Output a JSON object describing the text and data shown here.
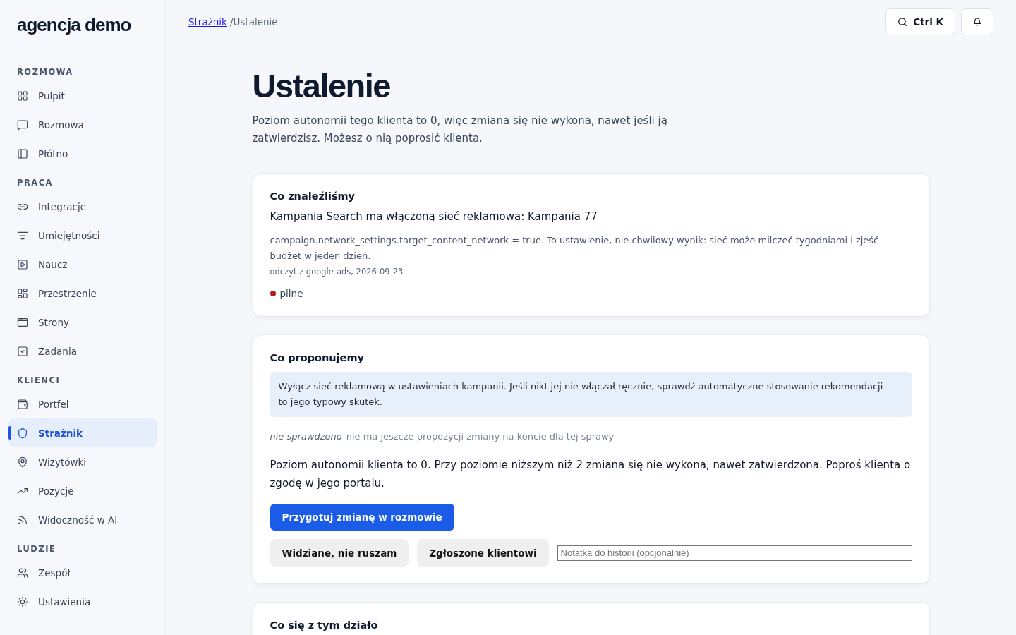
{
  "brand": "agencja demo",
  "sidebar": {
    "sections": [
      {
        "title": "ROZMOWA",
        "items": [
          {
            "label": "Pulpit",
            "selected": false
          },
          {
            "label": "Rozmowa",
            "selected": false
          },
          {
            "label": "Płótno",
            "selected": false
          }
        ]
      },
      {
        "title": "PRACA",
        "items": [
          {
            "label": "Integracje",
            "selected": false
          },
          {
            "label": "Umiejętności",
            "selected": false
          },
          {
            "label": "Naucz",
            "selected": false
          },
          {
            "label": "Przestrzenie",
            "selected": false
          },
          {
            "label": "Strony",
            "selected": false
          },
          {
            "label": "Zadania",
            "selected": false
          }
        ]
      },
      {
        "title": "KLIENCI",
        "items": [
          {
            "label": "Portfel",
            "selected": false
          },
          {
            "label": "Strażnik",
            "selected": true
          },
          {
            "label": "Wizytówki",
            "selected": false
          },
          {
            "label": "Pozycje",
            "selected": false
          },
          {
            "label": "Widoczność w AI",
            "selected": false
          }
        ]
      },
      {
        "title": "LUDZIE",
        "items": [
          {
            "label": "Zespół",
            "selected": false
          },
          {
            "label": "Ustawienia",
            "selected": false
          }
        ]
      }
    ]
  },
  "breadcrumb": {
    "link": "Strażnik",
    "current": "/Ustalenie"
  },
  "topbar": {
    "search_label": "Ctrl K"
  },
  "title": "Ustalenie",
  "subtitle": "Poziom autonomii tego klienta to 0, więc zmiana się nie wykona, nawet jeśli ją zatwierdzisz. Możesz o nią poprosić klienta.",
  "finding": {
    "heading": "Co znaleźliśmy",
    "title": "Kampania Search ma włączoną sieć reklamową: Kampania 77",
    "detail": "campaign.network_settings.target_content_network = true. To ustawienie, nie chwilowy wynik: sieć może milczeć tygodniami i zjeść budżet w jeden dzień.",
    "source": "odczyt z google-ads, 2026-09-23",
    "priority": {
      "label": "pilne",
      "color": "#b91c1c"
    }
  },
  "proposal": {
    "heading": "Co proponujemy",
    "recommendation": "Wyłącz sieć reklamową w ustawieniach kampanii. Jeśli nikt jej nie włączał ręcznie, sprawdź automatyczne stosowanie rekomendacji — to jego typowy skutek.",
    "check_status": "nie sprawdzono",
    "check_note": "nie ma jeszcze propozycji zmiany na koncie dla tej sprawy",
    "autonomy_note": "Poziom autonomii klienta to 0. Przy poziomie niższym niż 2 zmiana się nie wykona, nawet zatwierdzona. Poproś klienta o zgodę w jego portalu.",
    "primary_button": "Przygotuj zmianę w rozmowie",
    "secondary_buttons": [
      "Widziane, nie ruszam",
      "Zgłoszone klientowi"
    ],
    "note_placeholder": "Notatka do historii (opcjonalnie)"
  },
  "history": {
    "heading": "Co się z tym działo"
  }
}
